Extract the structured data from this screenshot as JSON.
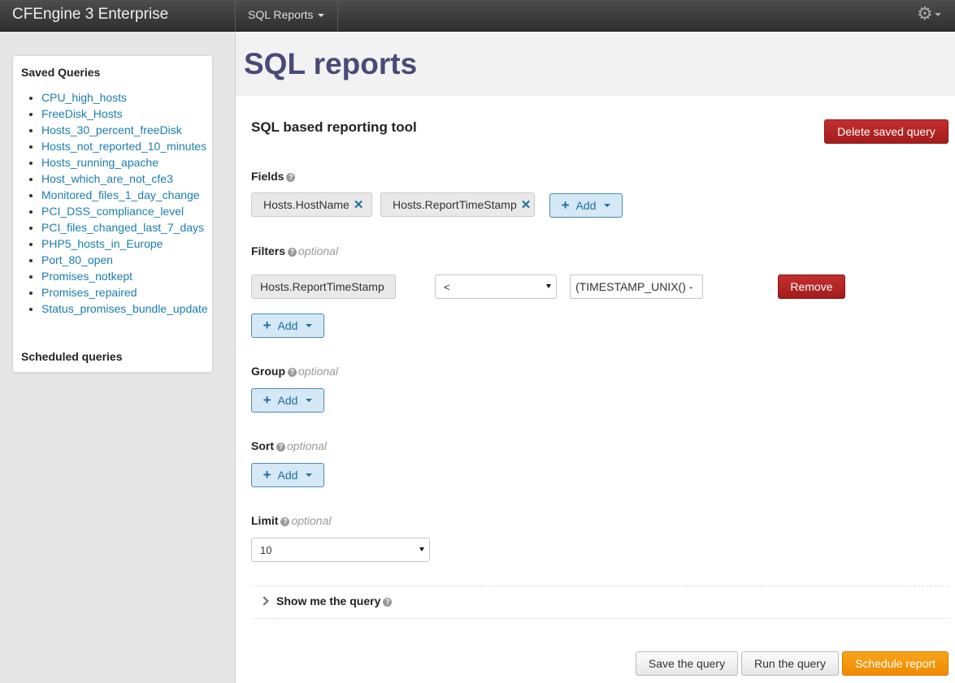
{
  "topbar": {
    "brand": "CFEngine 3 Enterprise",
    "nav_sql_reports": "SQL Reports",
    "settings_icon": "gear-icon"
  },
  "sidebar": {
    "saved_title": "Saved Queries",
    "saved_queries": [
      "CPU_high_hosts",
      "FreeDisk_Hosts",
      "Hosts_30_percent_freeDisk",
      "Hosts_not_reported_10_minutes",
      "Hosts_running_apache",
      "Host_which_are_not_cfe3",
      "Monitored_files_1_day_change",
      "PCI_DSS_compliance_level",
      "PCI_files_changed_last_7_days",
      "PHP5_hosts_in_Europe",
      "Port_80_open",
      "Promises_notkept",
      "Promises_repaired",
      "Status_promises_bundle_update"
    ],
    "scheduled_title": "Scheduled queries"
  },
  "page": {
    "title": "SQL reports",
    "subtitle": "SQL based reporting tool",
    "delete_button": "Delete saved query"
  },
  "fields": {
    "label": "Fields",
    "chips": [
      "Hosts.HostName",
      "Hosts.ReportTimeStamp"
    ],
    "remove_glyph": "✕",
    "add_label": "Add"
  },
  "filters": {
    "label": "Filters",
    "optional": "optional",
    "field": "Hosts.ReportTimeStamp",
    "operator": "<",
    "value": "(TIMESTAMP_UNIX() -",
    "remove_label": "Remove",
    "add_label": "Add"
  },
  "group": {
    "label": "Group",
    "optional": "optional",
    "add_label": "Add"
  },
  "sort": {
    "label": "Sort",
    "optional": "optional",
    "add_label": "Add"
  },
  "limit": {
    "label": "Limit",
    "optional": "optional",
    "value": "10"
  },
  "show_query": {
    "label": "Show me the query"
  },
  "actions": {
    "save": "Save the query",
    "run": "Run the query",
    "schedule": "Schedule report"
  },
  "colors": {
    "accent_red": "#a31c1c",
    "link_blue": "#1a7eb0",
    "title_purple": "#4a4a78",
    "orange": "#f08a00"
  }
}
